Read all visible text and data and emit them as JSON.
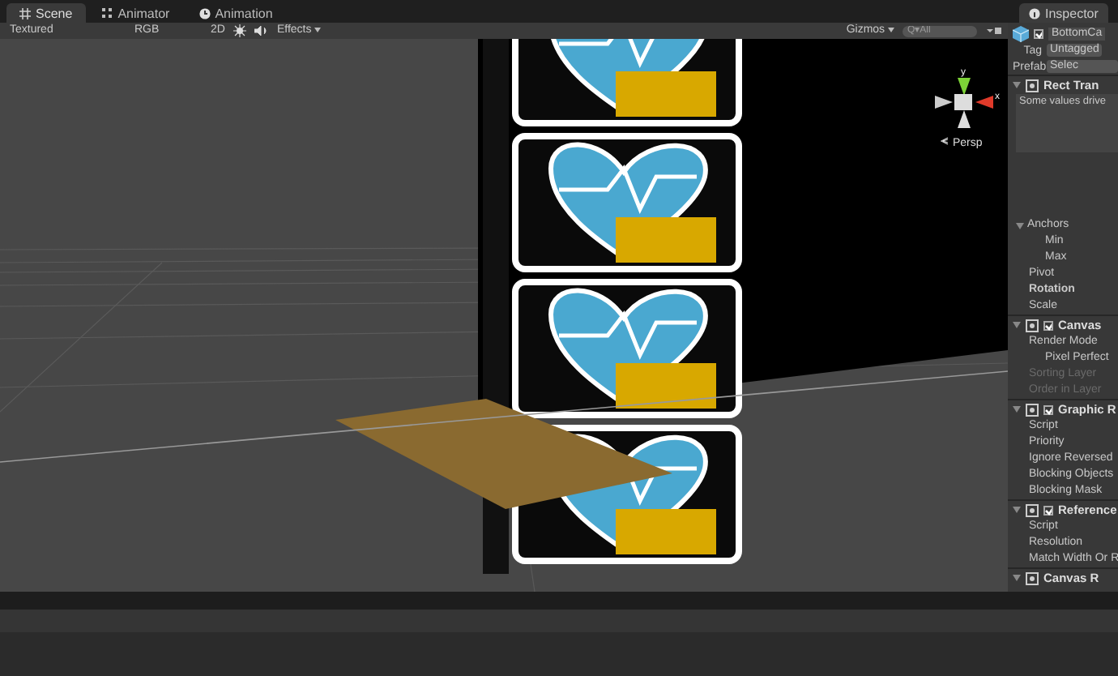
{
  "tabs": [
    {
      "label": "Scene",
      "selected": true
    },
    {
      "label": "Animator",
      "selected": false
    },
    {
      "label": "Animation",
      "selected": false
    }
  ],
  "toolbar": {
    "shading": "Textured",
    "channel": "RGB",
    "mode_2d": "2D",
    "effects": "Effects",
    "gizmos": "Gizmos",
    "search_placeholder": "Q▾All"
  },
  "scene": {
    "gizmo_label": "Persp",
    "axis_y": "y",
    "axis_x": "x"
  },
  "inspector": {
    "tab": "Inspector",
    "object_name": "BottomCa",
    "active": true,
    "tag_label": "Tag",
    "tag": "Untagged",
    "prefab_label": "Prefab",
    "prefab_button": "Selec",
    "components": [
      {
        "title": "Rect Tran",
        "expanded": true,
        "rows": [
          {
            "kind": "note",
            "label": "Some values drive"
          },
          {
            "kind": "group",
            "label": "Anchors",
            "expanded": true
          },
          {
            "kind": "indent",
            "label": "Min"
          },
          {
            "kind": "indent",
            "label": "Max"
          },
          {
            "kind": "field",
            "label": "Pivot"
          },
          {
            "kind": "bold",
            "label": "Rotation"
          },
          {
            "kind": "field",
            "label": "Scale"
          }
        ]
      },
      {
        "title": "Canvas",
        "enabled": true,
        "expanded": true,
        "rows": [
          {
            "kind": "field",
            "label": "Render Mode"
          },
          {
            "kind": "indent",
            "label": "Pixel Perfect"
          },
          {
            "kind": "disabled",
            "label": "Sorting Layer"
          },
          {
            "kind": "disabled",
            "label": "Order in Layer"
          }
        ]
      },
      {
        "title": "Graphic R",
        "enabled": true,
        "expanded": true,
        "rows": [
          {
            "kind": "field",
            "label": "Script"
          },
          {
            "kind": "field",
            "label": "Priority"
          },
          {
            "kind": "field",
            "label": "Ignore Reversed"
          },
          {
            "kind": "field",
            "label": "Blocking Objects"
          },
          {
            "kind": "field",
            "label": "Blocking Mask"
          }
        ]
      },
      {
        "title": "Reference",
        "enabled": true,
        "expanded": true,
        "rows": [
          {
            "kind": "field",
            "label": "Script"
          },
          {
            "kind": "field",
            "label": "Resolution"
          },
          {
            "kind": "field",
            "label": "Match Width Or R"
          }
        ]
      },
      {
        "title": "Canvas R",
        "expanded": true
      }
    ]
  }
}
